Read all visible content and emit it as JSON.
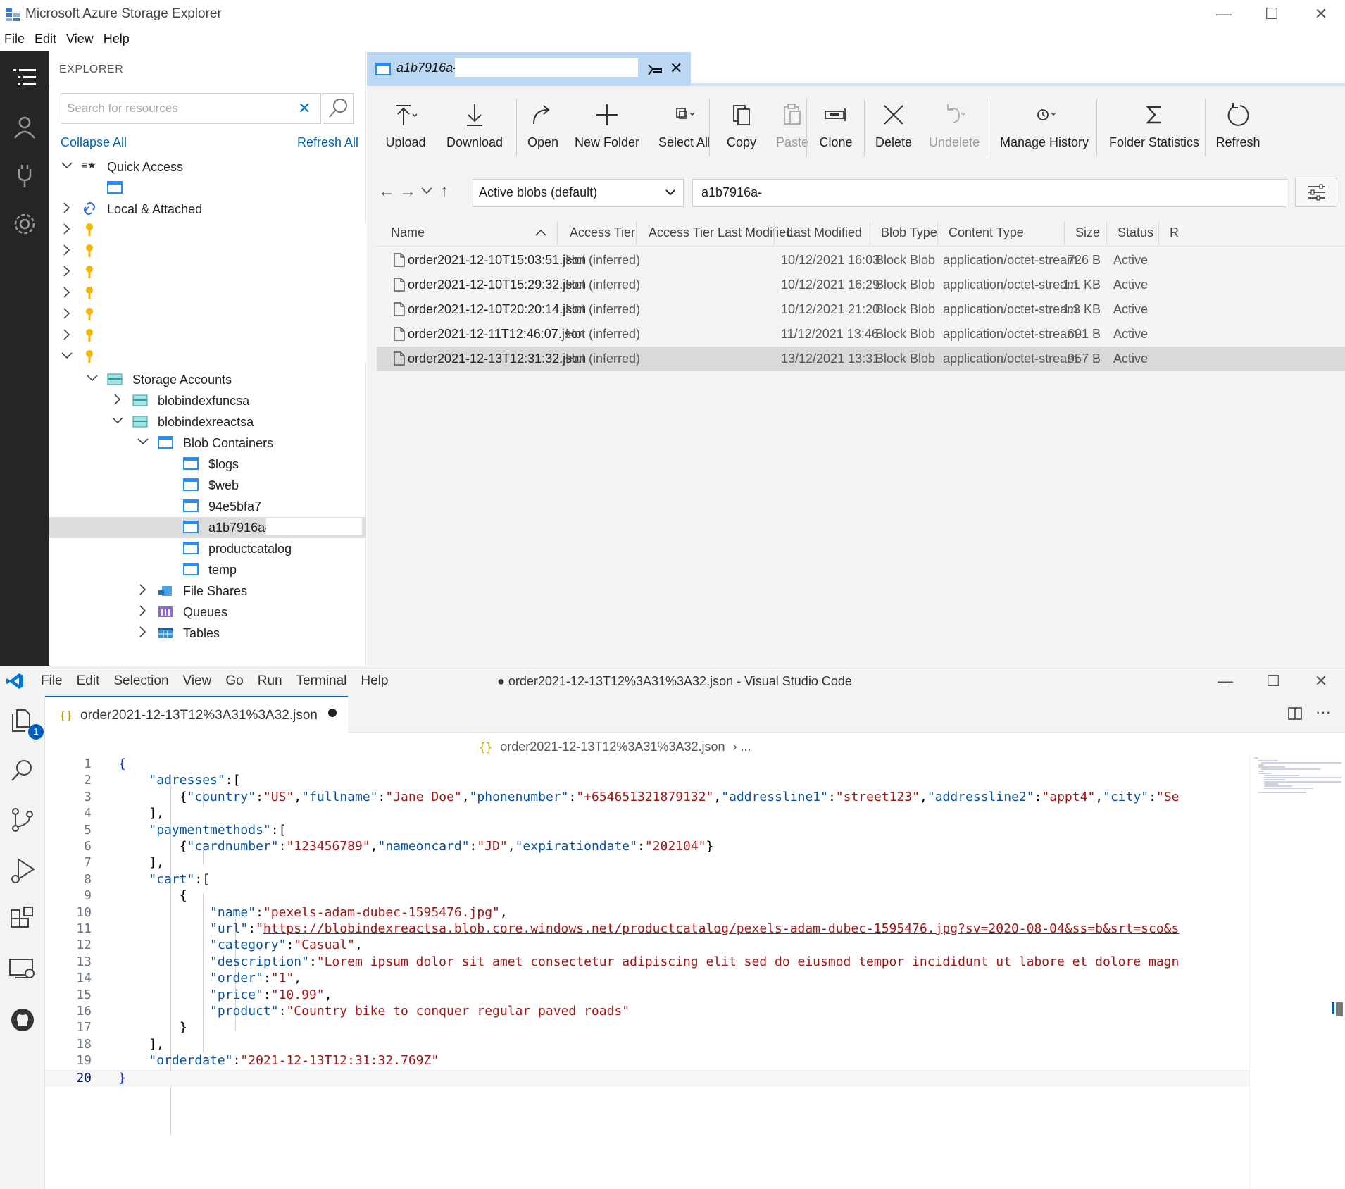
{
  "ase": {
    "title": "Microsoft Azure Storage Explorer",
    "menu": [
      "File",
      "Edit",
      "View",
      "Help"
    ],
    "sidebar": {
      "header": "EXPLORER",
      "search_placeholder": "Search for resources",
      "collapse_all": "Collapse All",
      "refresh_all": "Refresh All",
      "tree": {
        "quick_access": "Quick Access",
        "local_attached": "Local & Attached",
        "storage_accounts": "Storage Accounts",
        "account1": "blobindexfuncsa",
        "account2": "blobindexreactsa",
        "blob_containers": "Blob Containers",
        "containers": [
          "$logs",
          "$web",
          "94e5bfa7-",
          "a1b7916a-",
          "productcatalog",
          "temp"
        ],
        "file_shares": "File Shares",
        "queues": "Queues",
        "tables": "Tables"
      }
    },
    "tab": {
      "label": "a1b7916a-"
    },
    "toolbar": {
      "upload": "Upload",
      "download": "Download",
      "open": "Open",
      "new_folder": "New Folder",
      "select_all": "Select All",
      "copy": "Copy",
      "paste": "Paste",
      "clone": "Clone",
      "delete": "Delete",
      "undelete": "Undelete",
      "manage_history": "Manage History",
      "folder_statistics": "Folder Statistics",
      "refresh": "Refresh"
    },
    "view_select": "Active blobs (default)",
    "path": "a1b7916a-",
    "columns": {
      "name": "Name",
      "access_tier": "Access Tier",
      "access_tier_last_modified": "Access Tier Last Modified",
      "last_modified": "Last Modified",
      "blob_type": "Blob Type",
      "content_type": "Content Type",
      "size": "Size",
      "status": "Status",
      "more": "R"
    },
    "rows": [
      {
        "name": "order2021-12-10T15:03:51.json",
        "tier": "Hot (inferred)",
        "modified": "10/12/2021 16:03",
        "type": "Block Blob",
        "content": "application/octet-stream",
        "size": "726 B",
        "status": "Active"
      },
      {
        "name": "order2021-12-10T15:29:32.json",
        "tier": "Hot (inferred)",
        "modified": "10/12/2021 16:29",
        "type": "Block Blob",
        "content": "application/octet-stream",
        "size": "1.1 KB",
        "status": "Active"
      },
      {
        "name": "order2021-12-10T20:20:14.json",
        "tier": "Hot (inferred)",
        "modified": "10/12/2021 21:20",
        "type": "Block Blob",
        "content": "application/octet-stream",
        "size": "1.3 KB",
        "status": "Active"
      },
      {
        "name": "order2021-12-11T12:46:07.json",
        "tier": "Hot (inferred)",
        "modified": "11/12/2021 13:46",
        "type": "Block Blob",
        "content": "application/octet-stream",
        "size": "691 B",
        "status": "Active"
      },
      {
        "name": "order2021-12-13T12:31:32.json",
        "tier": "Hot (inferred)",
        "modified": "13/12/2021 13:31",
        "type": "Block Blob",
        "content": "application/octet-stream",
        "size": "957 B",
        "status": "Active"
      }
    ]
  },
  "vsc": {
    "menu": [
      "File",
      "Edit",
      "Selection",
      "View",
      "Go",
      "Run",
      "Terminal",
      "Help"
    ],
    "title": "● order2021-12-13T12%3A31%3A32.json - Visual Studio Code",
    "tab_label": "order2021-12-13T12%3A31%3A32.json",
    "tab_glyph": "{}",
    "breadcrumb": "order2021-12-13T12%3A31%3A32.json",
    "breadcrumb_more": "› ...",
    "explorer_badge": "1",
    "line_numbers": [
      "1",
      "2",
      "3",
      "4",
      "5",
      "6",
      "7",
      "8",
      "9",
      "10",
      "11",
      "12",
      "13",
      "14",
      "15",
      "16",
      "17",
      "18",
      "19",
      "20"
    ]
  },
  "colors": {
    "vsc_accent": "#005fb8",
    "json_key": "#0451a5",
    "json_string": "#a31515",
    "ase_tab": "#bcd7f2",
    "ase_link": "#0066b8"
  }
}
